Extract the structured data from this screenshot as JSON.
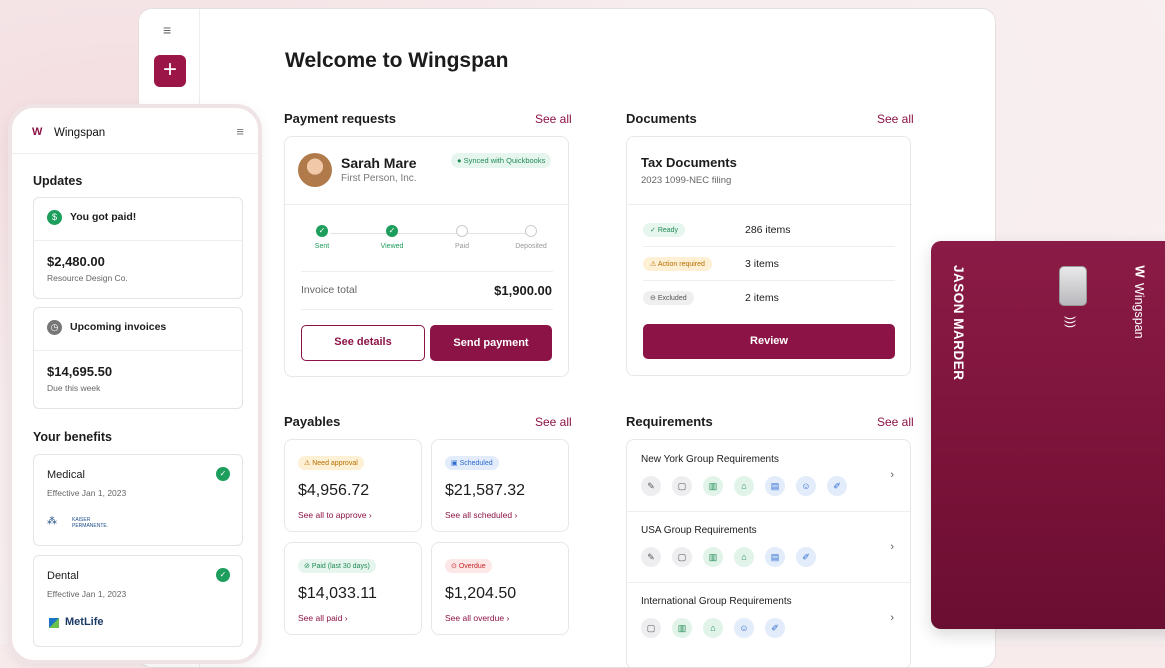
{
  "header": {
    "title": "Welcome to Wingspan"
  },
  "payment_requests": {
    "title": "Payment requests",
    "see_all": "See all",
    "name": "Sarah Mare",
    "company": "First Person, Inc.",
    "synced": "Synced with Quickbooks",
    "steps": [
      "Sent",
      "Viewed",
      "Paid",
      "Deposited"
    ],
    "invoice_label": "Invoice total",
    "invoice_total": "$1,900.00",
    "details_button": "See details",
    "send_button": "Send payment"
  },
  "documents": {
    "title": "Documents",
    "see_all": "See all",
    "card_title": "Tax Documents",
    "card_sub": "2023 1099-NEC filing",
    "rows": [
      {
        "badge": "Ready",
        "count": "286 items"
      },
      {
        "badge": "Action required",
        "count": "3 items"
      },
      {
        "badge": "Excluded",
        "count": "2 items"
      }
    ],
    "review_button": "Review"
  },
  "payables": {
    "title": "Payables",
    "see_all": "See all",
    "cards": [
      {
        "badge": "Need approval",
        "amount": "$4,956.72",
        "link": "See all to approve"
      },
      {
        "badge": "Scheduled",
        "amount": "$21,587.32",
        "link": "See all scheduled"
      },
      {
        "badge": "Paid (last 30 days)",
        "amount": "$14,033.11",
        "link": "See all paid"
      },
      {
        "badge": "Overdue",
        "amount": "$1,204.50",
        "link": "See all overdue"
      }
    ]
  },
  "requirements": {
    "title": "Requirements",
    "see_all": "See all",
    "items": [
      {
        "label": "New York Group Requirements"
      },
      {
        "label": "USA Group Requirements"
      },
      {
        "label": "International Group Requirements"
      }
    ]
  },
  "mobile": {
    "brand": "Wingspan",
    "updates_title": "Updates",
    "paid_title": "You got paid!",
    "paid_amount": "$2,480.00",
    "paid_from": "Resource Design Co.",
    "upcoming_title": "Upcoming invoices",
    "upcoming_amount": "$14,695.50",
    "upcoming_sub": "Due this week",
    "benefits_title": "Your benefits",
    "medical": {
      "title": "Medical",
      "sub": "Effective Jan 1, 2023",
      "provider": "KAISER PERMANENTE."
    },
    "dental": {
      "title": "Dental",
      "sub": "Effective Jan 1, 2023",
      "provider": "MetLife"
    }
  },
  "card": {
    "holder": "JASON MARDER",
    "brand": "Wingspan"
  },
  "colors": {
    "brand": "#8c1346",
    "success": "#1d9e5c"
  }
}
